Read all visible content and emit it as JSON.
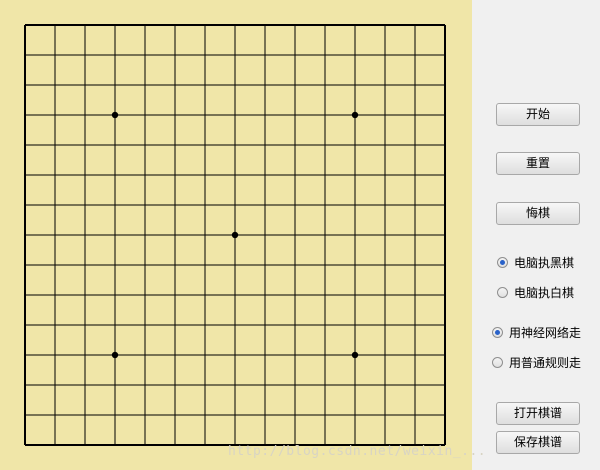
{
  "board": {
    "size": 15,
    "background_color": "#f0e6a8",
    "line_color": "#000000",
    "star_points": [
      [
        3,
        3
      ],
      [
        11,
        3
      ],
      [
        7,
        7
      ],
      [
        3,
        11
      ],
      [
        11,
        11
      ]
    ]
  },
  "buttons": {
    "start": "开始",
    "reset": "重置",
    "undo": "悔棋",
    "open_record": "打开棋谱",
    "save_record": "保存棋谱"
  },
  "color_options": {
    "items": [
      {
        "label": "电脑执黑棋",
        "checked": true
      },
      {
        "label": "电脑执白棋",
        "checked": false
      }
    ]
  },
  "mode_options": {
    "items": [
      {
        "label": "用神经网络走",
        "checked": true
      },
      {
        "label": "用普通规则走",
        "checked": false
      }
    ]
  },
  "watermark": "http://blog.csdn.net/weixin_..."
}
